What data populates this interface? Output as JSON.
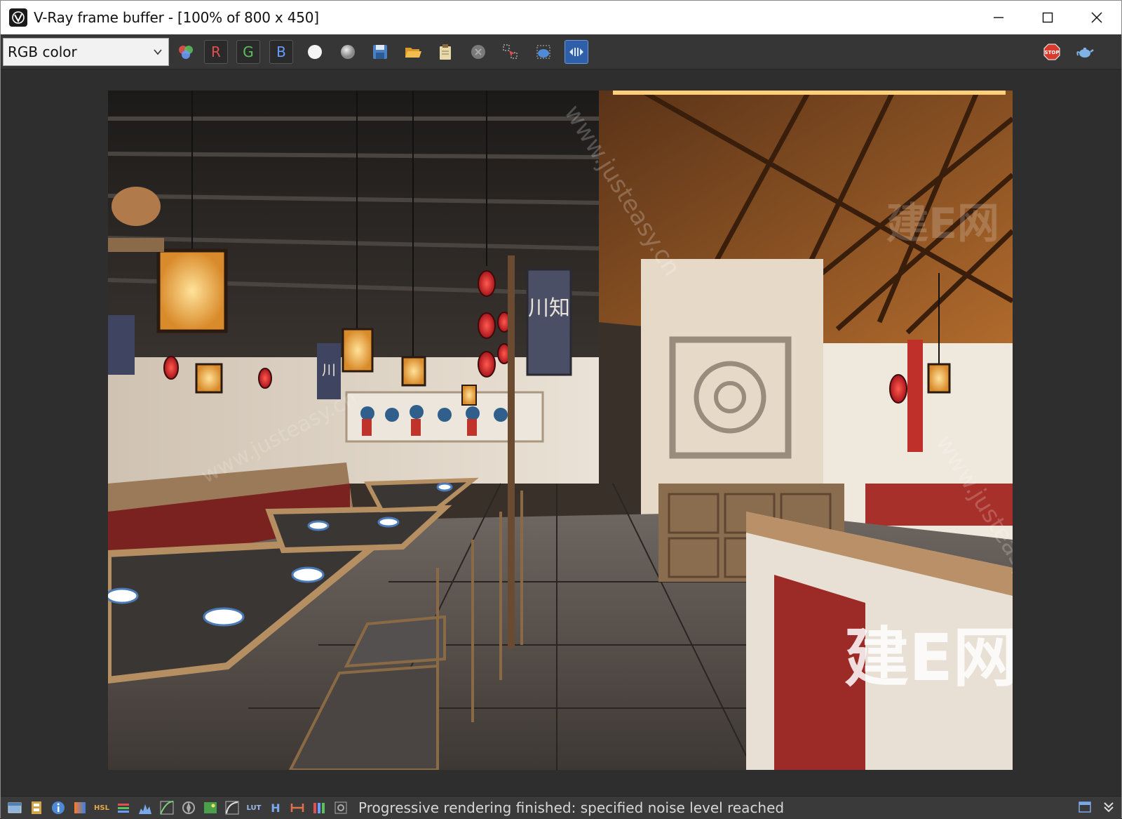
{
  "window": {
    "title": "V-Ray frame buffer - [100% of 800 x 450]"
  },
  "toolbar": {
    "channel_selected": "RGB color",
    "r_label": "R",
    "g_label": "G",
    "b_label": "B",
    "stop_label": "STOP"
  },
  "statusbar": {
    "message": "Progressive rendering finished: specified noise level reached",
    "hsl_label": "HSL",
    "lut_label": "LUT",
    "h_label": "H"
  },
  "watermarks": {
    "cn_logo": "建E网",
    "url": "www.justeasy.cn"
  },
  "render_scene": {
    "banner_left": "川",
    "banner_right": "川知"
  },
  "colors": {
    "title_bg": "#ffffff",
    "toolbar_bg": "#363636",
    "viewport_bg": "#2e2e2e",
    "r_color": "#e05050",
    "g_color": "#5cc05c",
    "b_color": "#6a9cff",
    "stop_red": "#d83a2e"
  }
}
